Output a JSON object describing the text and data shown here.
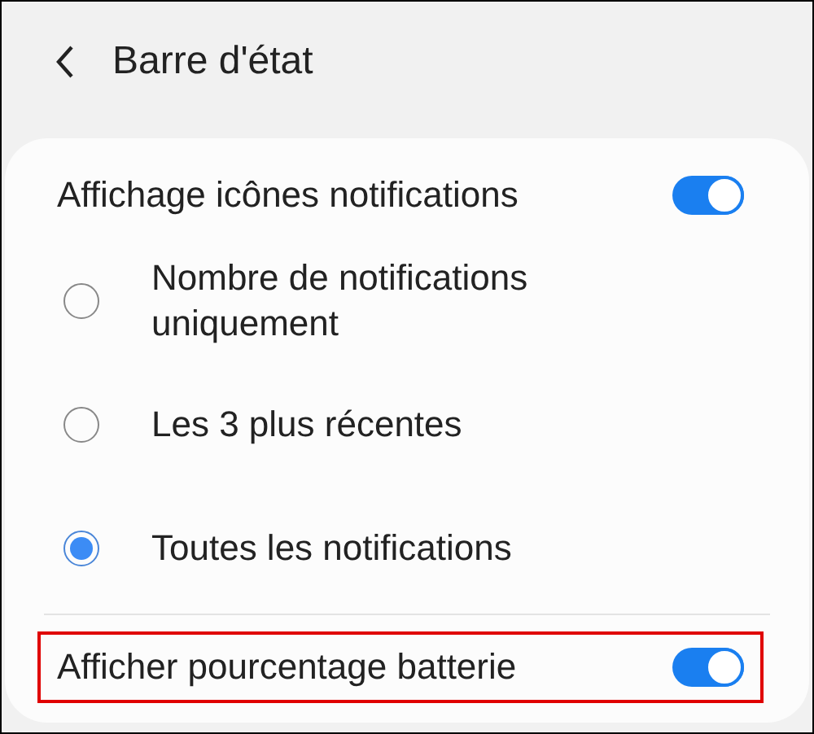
{
  "header": {
    "title": "Barre d'état"
  },
  "settings": [
    {
      "kind": "toggle",
      "label": "Affichage icônes notifications",
      "on": true,
      "highlighted": false
    },
    {
      "kind": "radio",
      "label": "Nombre de notifications uniquement",
      "selected": false
    },
    {
      "kind": "radio",
      "label": "Les 3 plus récentes",
      "selected": false
    },
    {
      "kind": "radio",
      "label": "Toutes les notifications",
      "selected": true
    },
    {
      "kind": "toggle",
      "label": "Afficher pourcentage batterie",
      "on": true,
      "highlighted": true
    }
  ]
}
